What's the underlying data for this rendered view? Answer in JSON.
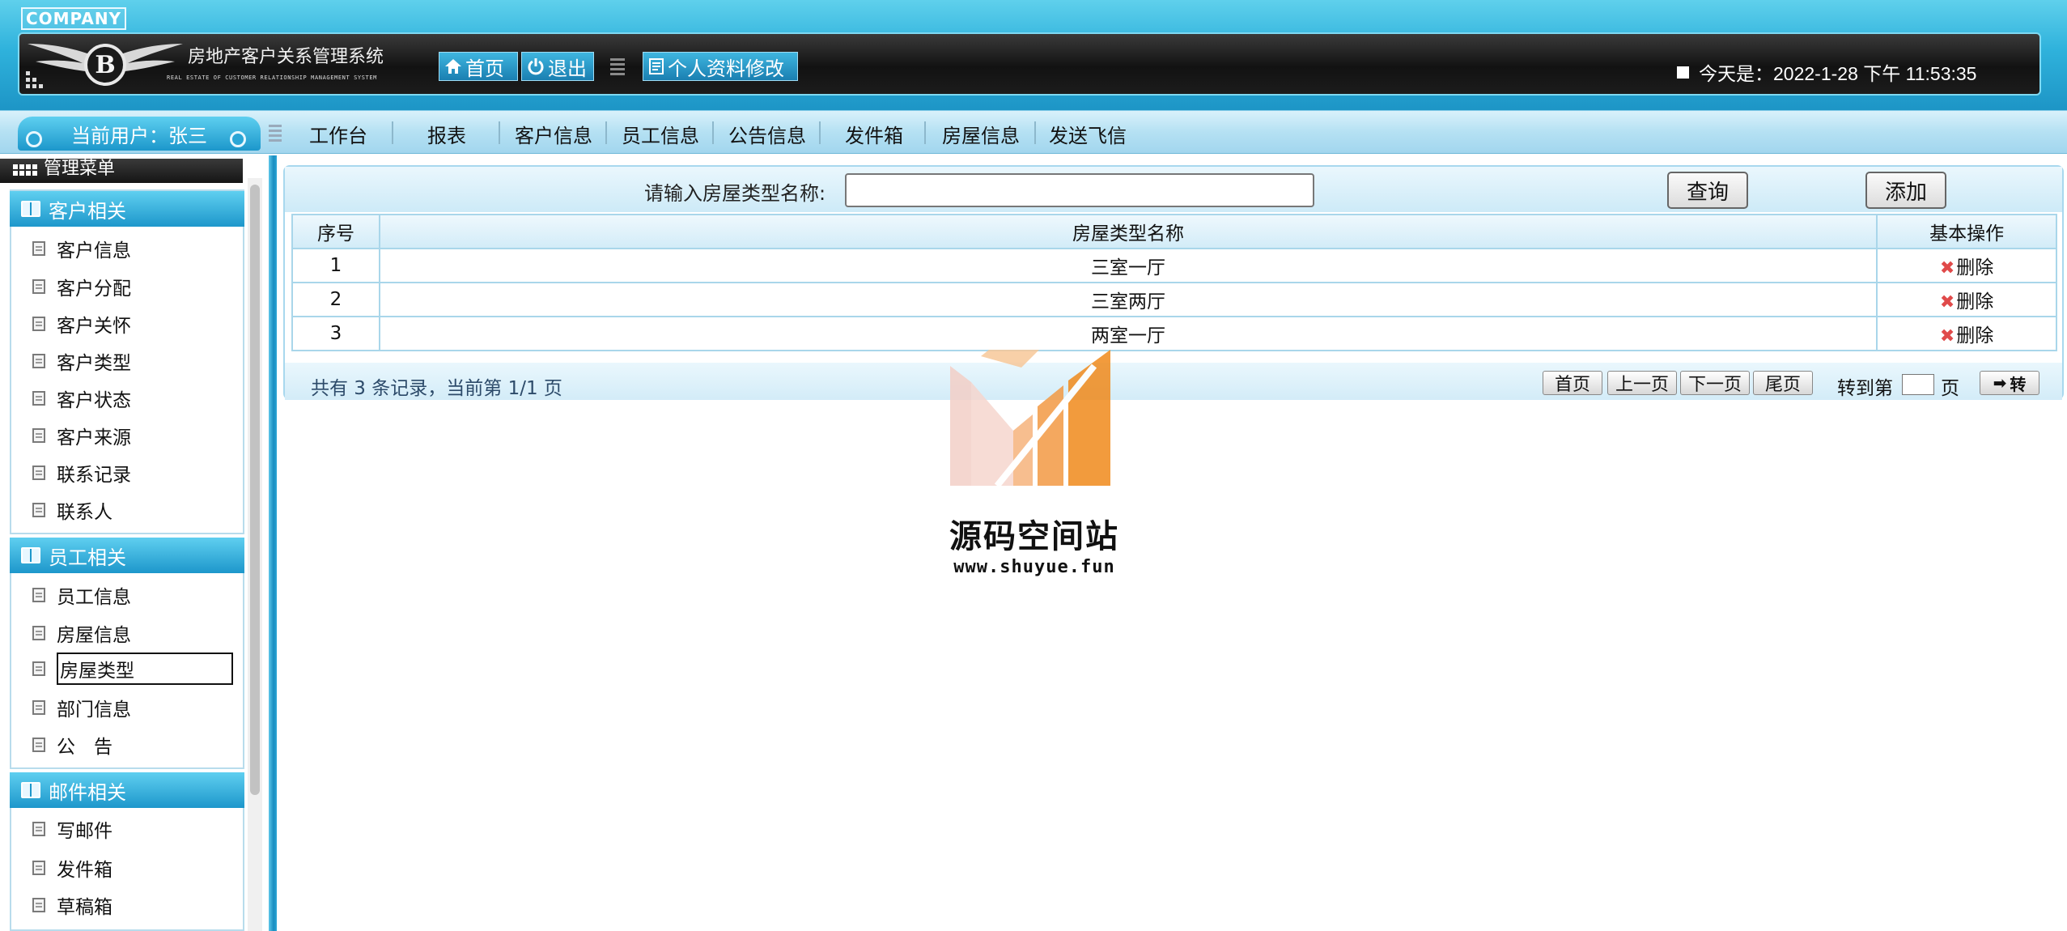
{
  "header": {
    "company": "COMPANY",
    "system_title": "房地产客户关系管理系统",
    "system_subtitle": "REAL ESTATE OF CUSTOMER RELATIONSHIP MANAGEMENT SYSTEM",
    "home_label": "首页",
    "logout_label": "退出",
    "profile_label": "个人资料修改",
    "date_text": "今天是：2022-1-28 下午 11:53:35"
  },
  "navbar": {
    "current_user": "当前用户：张三",
    "items": [
      "工作台",
      "报表",
      "客户信息",
      "员工信息",
      "公告信息",
      "发件箱",
      "房屋信息",
      "发送飞信"
    ]
  },
  "sidebar": {
    "menu_title": "管理菜单",
    "groups": [
      {
        "title": "客户相关",
        "items": [
          "客户信息",
          "客户分配",
          "客户关怀",
          "客户类型",
          "客户状态",
          "客户来源",
          "联系记录",
          "联系人"
        ]
      },
      {
        "title": "员工相关",
        "items": [
          "员工信息",
          "房屋信息",
          "房屋类型",
          "部门信息",
          "公　告"
        ]
      },
      {
        "title": "邮件相关",
        "items": [
          "写邮件",
          "发件箱",
          "草稿箱"
        ]
      }
    ],
    "selected_item": "房屋类型"
  },
  "search": {
    "label": "请输入房屋类型名称:",
    "value": "",
    "query_label": "查询",
    "add_label": "添加"
  },
  "table": {
    "columns": [
      "序号",
      "房屋类型名称",
      "基本操作"
    ],
    "rows": [
      {
        "index": "1",
        "name": "三室一厅",
        "action": "删除"
      },
      {
        "index": "2",
        "name": "三室两厅",
        "action": "删除"
      },
      {
        "index": "3",
        "name": "两室一厅",
        "action": "删除"
      }
    ]
  },
  "pagination": {
    "info": "共有 3 条记录，当前第 1/1 页",
    "first": "首页",
    "prev": "上一页",
    "next": "下一页",
    "last": "尾页",
    "goto_label": "转到第",
    "goto_unit": "页",
    "go_label": "转",
    "goto_value": ""
  },
  "watermark": {
    "title": "源码空间站",
    "url": "www.shuyue.fun"
  },
  "colors": {
    "accent": "#1d97cb",
    "header_dark": "#151515",
    "delete_icon": "#e04a4a",
    "watermark_orange": "#f08a1c"
  }
}
